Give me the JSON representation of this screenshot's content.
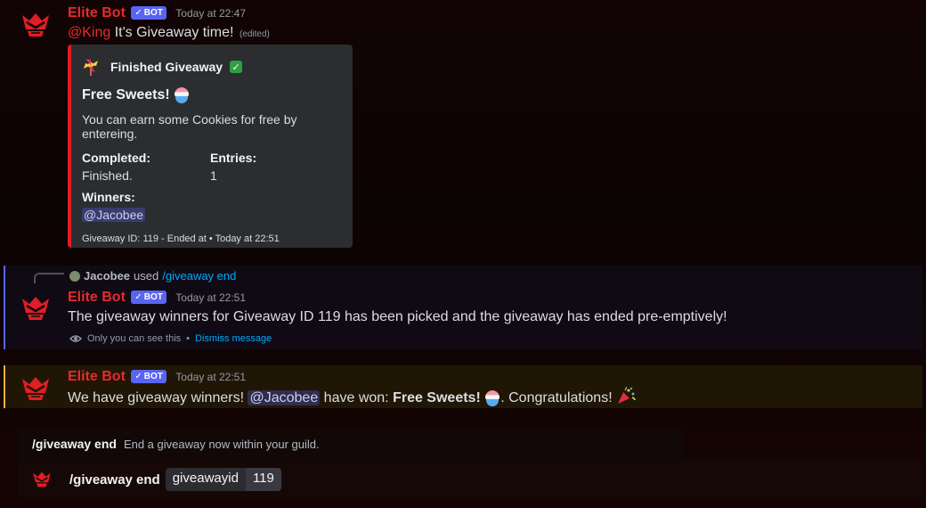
{
  "message1": {
    "username": "Elite Bot",
    "bot_tag": "BOT",
    "timestamp": "Today at 22:47",
    "mention": "@King",
    "text": "It's Giveaway time!",
    "edited": "(edited)",
    "embed": {
      "author": "Finished Giveaway",
      "title": "Free Sweets!",
      "description": "You can earn some Cookies for free by entereing.",
      "fields": [
        {
          "name": "Completed:",
          "value": "Finished."
        },
        {
          "name": "Entries:",
          "value": "1"
        }
      ],
      "winners_label": "Winners:",
      "winner": "@Jacobee",
      "footer": "Giveaway ID: 119 - Ended at • Today at 22:51",
      "accent_color": "#e01e24"
    }
  },
  "message2": {
    "reply_user": "Jacobee",
    "reply_used": "used",
    "reply_command": "/giveaway end",
    "username": "Elite Bot",
    "bot_tag": "BOT",
    "timestamp": "Today at 22:51",
    "text": "The giveaway winners for Giveaway ID 119 has been picked and the giveaway has ended pre-emptively!",
    "ephemeral_note": "Only you can see this",
    "separator": "•",
    "dismiss": "Dismiss message"
  },
  "message3": {
    "username": "Elite Bot",
    "bot_tag": "BOT",
    "timestamp": "Today at 22:51",
    "text_before": "We have giveaway winners!",
    "mention": "@Jacobee",
    "text_mid": "have won:",
    "prize": "Free Sweets!",
    "text_after": ". Congratulations!"
  },
  "autocomplete": {
    "command": "/giveaway end",
    "description": "End a giveaway now within your guild."
  },
  "composer": {
    "command": "/giveaway end",
    "option_name": "giveawayid",
    "option_value": "119"
  },
  "colors": {
    "brand_red": "#e62b2b",
    "bot_tag": "#5865f2",
    "link": "#00a8fc"
  }
}
